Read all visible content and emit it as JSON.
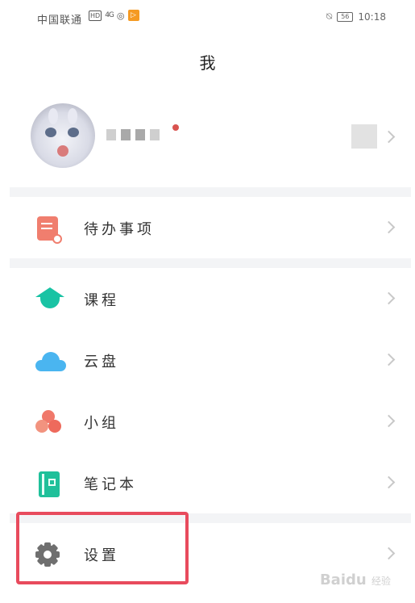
{
  "status_bar": {
    "carrier": "中国联通",
    "hd": "HD",
    "signal": "4G",
    "battery": "56",
    "time": "10:18"
  },
  "page": {
    "title": "我"
  },
  "profile": {
    "avatar_icon": "avatar-image"
  },
  "menu": {
    "todo": {
      "label": "待办事项",
      "icon": "todo-icon"
    },
    "course": {
      "label": "课程",
      "icon": "graduation-cap-icon"
    },
    "cloud": {
      "label": "云盘",
      "icon": "cloud-icon"
    },
    "group": {
      "label": "小组",
      "icon": "group-icon"
    },
    "notebook": {
      "label": "笔记本",
      "icon": "notebook-icon"
    },
    "settings": {
      "label": "设置",
      "icon": "gear-icon"
    }
  },
  "watermark": {
    "brand": "Baidu",
    "sub": "经验"
  },
  "colors": {
    "highlight": "#e84b5d",
    "teal": "#19c3a4",
    "cloud_blue": "#4ab5f0",
    "coral": "#f07e6e",
    "separator": "#f3f4f6"
  }
}
